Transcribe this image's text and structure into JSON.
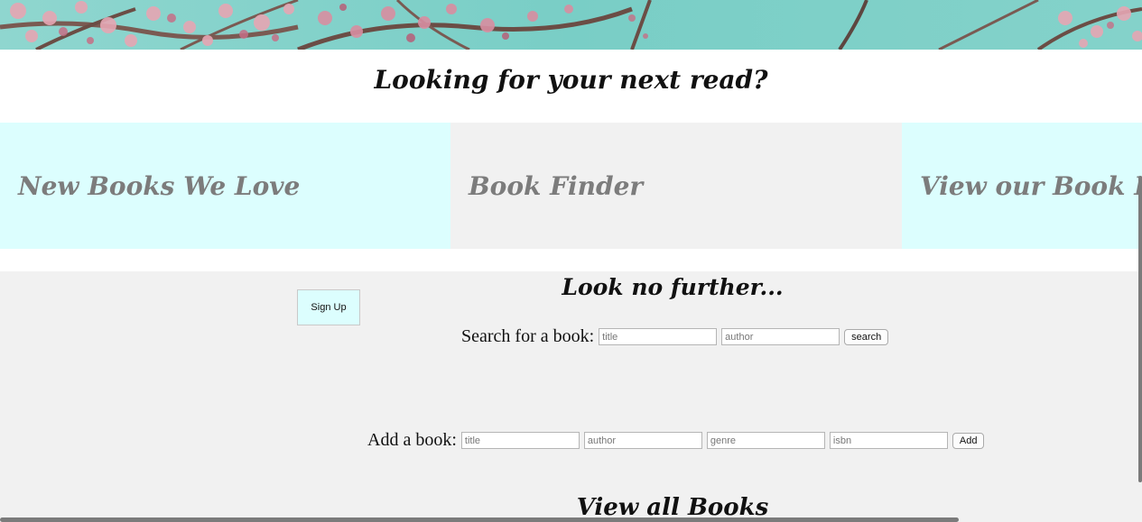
{
  "header": {
    "tagline": "Looking for your next read?"
  },
  "nav_tiles": [
    {
      "label": "New Books We Love"
    },
    {
      "label": "Book Finder"
    },
    {
      "label": "View our Book Lists"
    }
  ],
  "main": {
    "signup_label": "Sign Up",
    "heading": "Look no further...",
    "search_form": {
      "label": "Search for a book:",
      "title_placeholder": "title",
      "author_placeholder": "author",
      "button_label": "search"
    },
    "add_form": {
      "label": "Add a book:",
      "title_placeholder": "title",
      "author_placeholder": "author",
      "genre_placeholder": "genre",
      "isbn_placeholder": "isbn",
      "button_label": "Add"
    },
    "view_all_heading": "View all Books"
  },
  "colors": {
    "tile_cyan": "#dcfefe",
    "tile_grey": "#f1f1f1",
    "tile_text": "#7c7c7c",
    "photo_sky": "#7fcfc8"
  }
}
